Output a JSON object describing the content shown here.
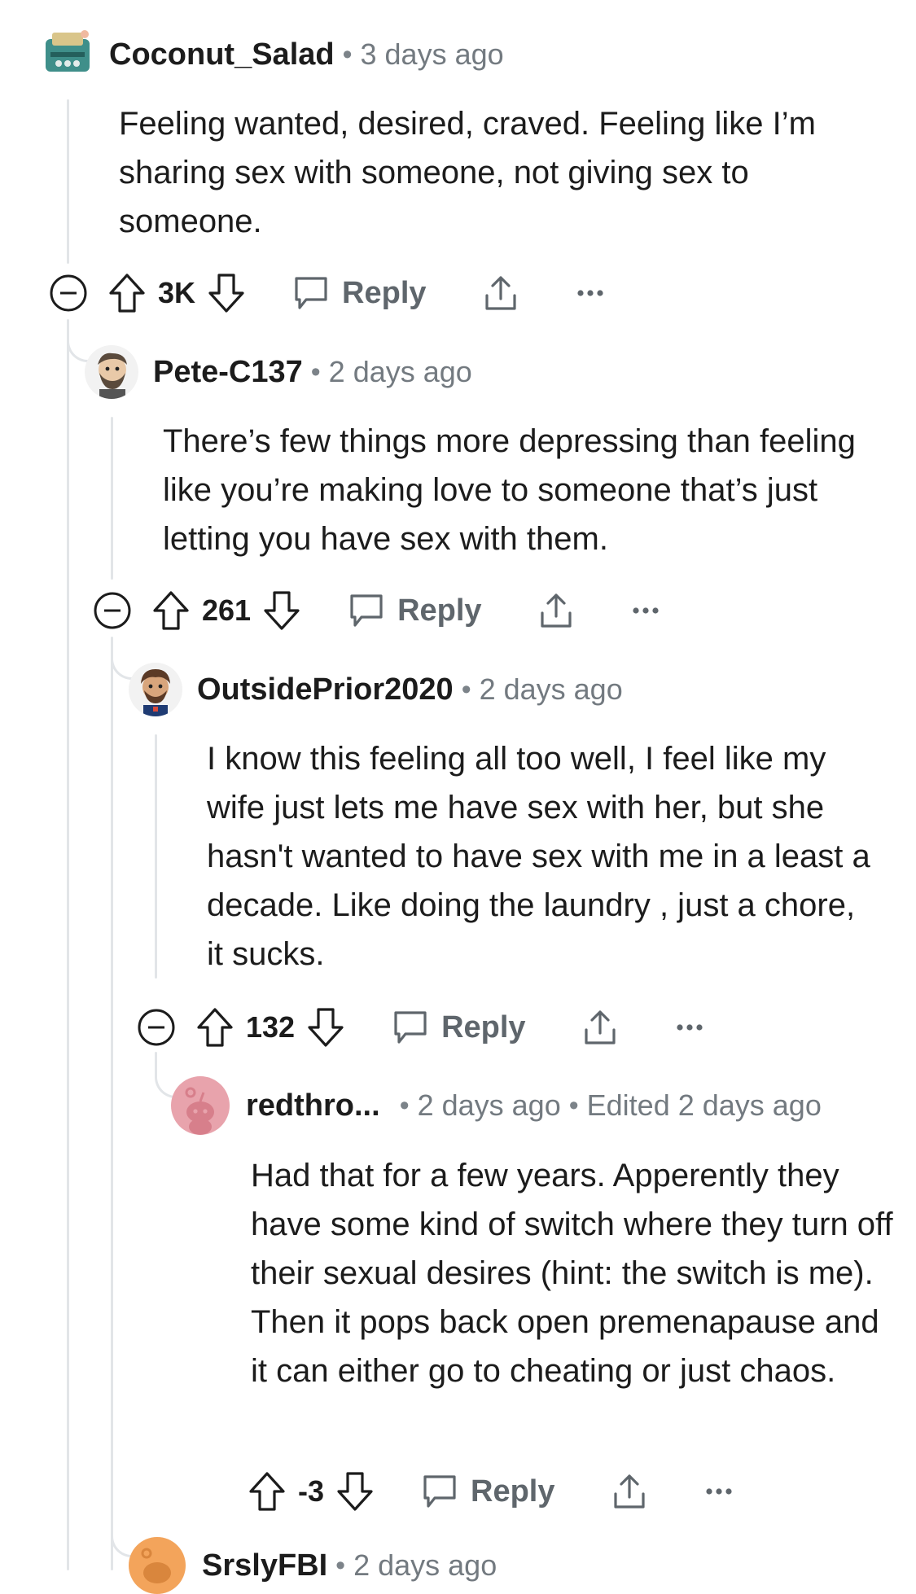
{
  "comments": [
    {
      "username": "Coconut_Salad",
      "time": "3 days ago",
      "edited": "",
      "text": "Feeling wanted, desired, craved. Feeling like I’m sharing sex with someone, not giving sex to someone.",
      "score": "3K",
      "reply_label": "Reply",
      "avatar": "typewriter-avatar"
    },
    {
      "username": "Pete-C137",
      "time": "2 days ago",
      "edited": "",
      "text": "There’s few things more depressing than feeling like you’re making love to someone that’s just letting you have sex with them.",
      "score": "261",
      "reply_label": "Reply",
      "avatar": "bearded-man-avatar"
    },
    {
      "username": "OutsidePrior2020",
      "time": "2 days ago",
      "edited": "",
      "text": "I know this feeling all too well, I feel like my wife just lets me have sex with her, but she hasn't wanted to have sex with me in a least a decade. Like doing the laundry , just a chore, it sucks.",
      "score": "132",
      "reply_label": "Reply",
      "avatar": "brown-hair-avatar"
    },
    {
      "username": "redthro...",
      "time": "2 days ago",
      "edited": "Edited 2 days ago",
      "text": "Had that for a few years. Apperently they have some kind of switch where they turn off their sexual desires (hint: the switch is me). Then it pops back open premenapause and it can either go to cheating or just chaos.",
      "score": "-3",
      "reply_label": "Reply",
      "avatar": "default-snoo-avatar"
    }
  ],
  "partial_next": {
    "username": "SrslyFBI",
    "time": "2 days ago"
  },
  "colors": {
    "thread_line": "#e2e5e8",
    "muted_text": "#737a80",
    "icon": "#5f666c",
    "snoo_pink": "#e8a3ac",
    "snoo_orange": "#f3a45b"
  }
}
